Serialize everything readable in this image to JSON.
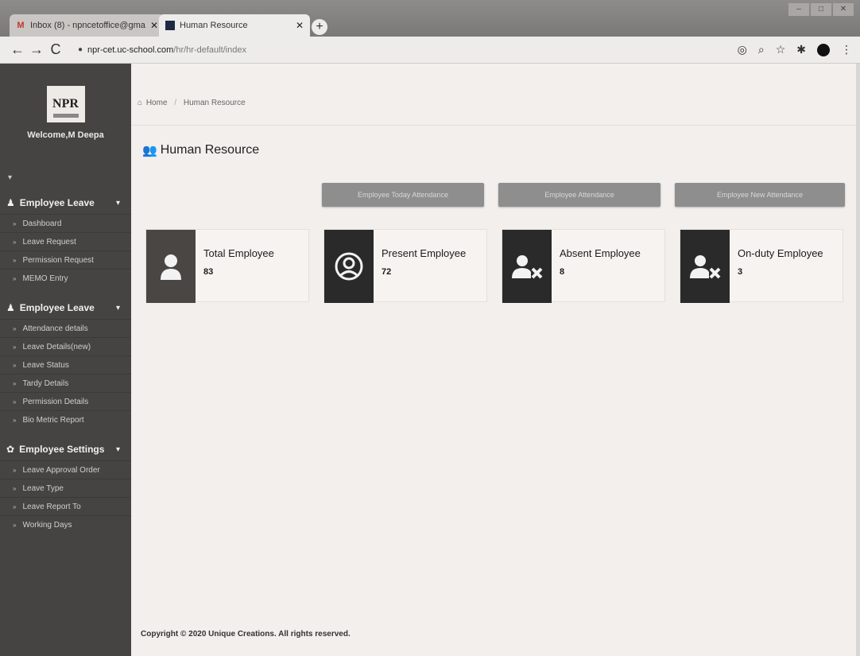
{
  "browser": {
    "tabs": [
      {
        "title": "Inbox (8) - npncetoffice@gmail",
        "icon": "gmail-icon",
        "active": false
      },
      {
        "title": "Human Resource",
        "icon": "site-icon",
        "active": true
      }
    ],
    "url_host": "npr-cet.uc-school.com",
    "url_path": "/hr/hr-default/index"
  },
  "sidebar": {
    "logo_text": "NPR",
    "welcome": "Welcome,M Deepa",
    "sections": [
      {
        "label": "Employee Leave",
        "icon": "user-icon",
        "items": [
          "Dashboard",
          "Leave Request",
          "Permission Request",
          "MEMO Entry"
        ]
      },
      {
        "label": "Employee Leave",
        "icon": "user-icon",
        "items": [
          "Attendance details",
          "Leave Details(new)",
          "Leave Status",
          "Tardy Details",
          "Permission Details",
          "Bio Metric Report"
        ]
      },
      {
        "label": "Employee Settings",
        "icon": "gear-icon",
        "items": [
          "Leave Approval Order",
          "Leave Type",
          "Leave Report To",
          "Working Days"
        ]
      }
    ]
  },
  "main": {
    "breadcrumb": {
      "home": "Home",
      "current": "Human Resource"
    },
    "title": "Human Resource",
    "actions": [
      "Employee Today Attendance",
      "Employee Attendance",
      "Employee New Attendance"
    ],
    "stats": [
      {
        "label": "Total Employee",
        "count": "83",
        "icon": "user-icon"
      },
      {
        "label": "Present Employee",
        "count": "72",
        "icon": "user-circle-icon"
      },
      {
        "label": "Absent Employee",
        "count": "8",
        "icon": "user-times-icon"
      },
      {
        "label": "On-duty Employee",
        "count": "3",
        "icon": "user-times-icon"
      }
    ],
    "footer": "Copyright © 2020 Unique Creations. All rights reserved."
  }
}
